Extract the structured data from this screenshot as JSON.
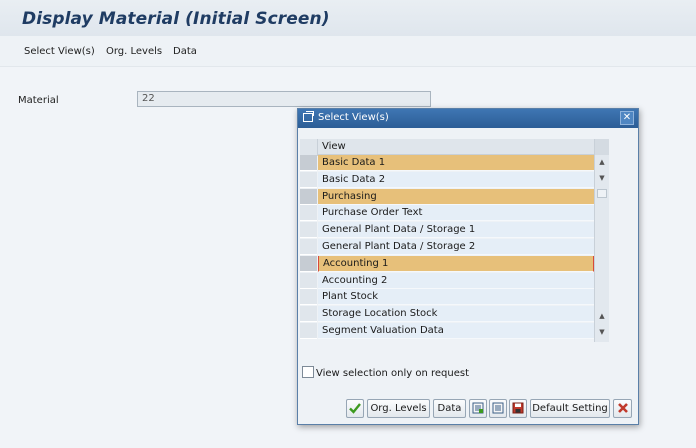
{
  "window": {
    "title": "Display Material (Initial Screen)"
  },
  "menu": [
    "Select View(s)",
    "Org. Levels",
    "Data"
  ],
  "material": {
    "label": "Material",
    "value": "22"
  },
  "dialog": {
    "title": "Select View(s)",
    "column_header": "View",
    "rows": [
      {
        "label": "Basic Data 1",
        "selected": true
      },
      {
        "label": "Basic Data 2",
        "selected": false
      },
      {
        "label": "Purchasing",
        "selected": true
      },
      {
        "label": "Purchase Order Text",
        "selected": false
      },
      {
        "label": "General Plant Data / Storage 1",
        "selected": false
      },
      {
        "label": "General Plant Data / Storage 2",
        "selected": false
      },
      {
        "label": "Accounting 1",
        "selected": true,
        "focused": true
      },
      {
        "label": "Accounting 2",
        "selected": false
      },
      {
        "label": "Plant Stock",
        "selected": false
      },
      {
        "label": "Storage Location Stock",
        "selected": false
      },
      {
        "label": "Segment Valuation Data",
        "selected": false
      }
    ],
    "checkbox_label": "View selection only on request",
    "checkbox_checked": false,
    "buttons": {
      "continue_icon": "check-icon",
      "org_levels": "Org. Levels",
      "data": "Data",
      "select_all_icon": "select-all-icon",
      "deselect_all_icon": "deselect-all-icon",
      "save_icon": "save-icon",
      "default_setting": "Default Setting",
      "cancel_icon": "cancel-icon"
    }
  },
  "colors": {
    "selected_row": "#e7c07a",
    "row": "#e5eef7",
    "dialog_header": "#2c5d96",
    "title": "#1f3c63"
  }
}
